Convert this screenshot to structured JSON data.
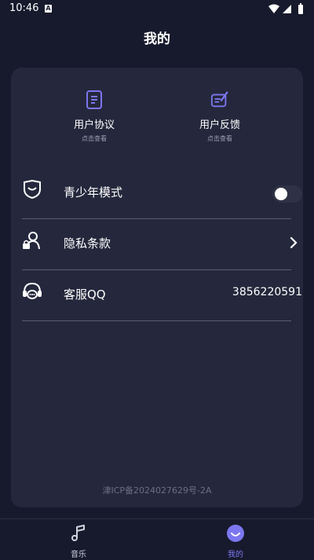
{
  "status_bar": {
    "time": "10:46",
    "notif_letter": "A"
  },
  "header": {
    "title": "我的"
  },
  "quick_actions": [
    {
      "label": "用户协议",
      "sub": "点击查看"
    },
    {
      "label": "用户反馈",
      "sub": "点击查看"
    }
  ],
  "settings": {
    "teen_mode": {
      "label": "青少年模式",
      "enabled": false
    },
    "privacy": {
      "label": "隐私条款"
    },
    "support": {
      "label": "客服QQ",
      "value": "3856220591"
    }
  },
  "footer": {
    "icp": "津ICP备2024027629号-2A"
  },
  "bottom_nav": [
    {
      "label": "音乐",
      "active": false
    },
    {
      "label": "我的",
      "active": true
    }
  ],
  "colors": {
    "background": "#171a2c",
    "card": "#25283c",
    "accent": "#7c77f0",
    "divider": "#5a5e72"
  }
}
